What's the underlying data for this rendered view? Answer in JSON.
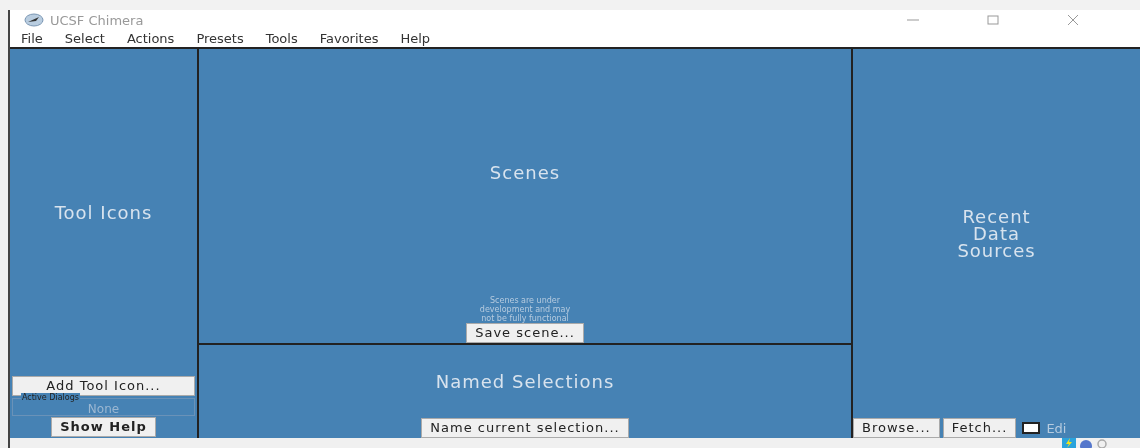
{
  "window": {
    "title": "UCSF Chimera"
  },
  "menu": [
    "File",
    "Select",
    "Actions",
    "Presets",
    "Tools",
    "Favorites",
    "Help"
  ],
  "tool_panel": {
    "title": "Tool Icons",
    "add_button": "Add Tool Icon...",
    "active_dialogs": {
      "label": "Active Dialogs",
      "value": "None"
    },
    "help_button": "Show Help"
  },
  "scenes": {
    "title": "Scenes",
    "note": "Scenes are under development and may not be fully functional",
    "save_button": "Save scene..."
  },
  "named_selections": {
    "title": "Named Selections",
    "button": "Name current selection..."
  },
  "recent": {
    "title": "Recent Data Sources",
    "buttons": [
      "Browse...",
      "Fetch..."
    ],
    "edit_checkbox": {
      "label": "Edi",
      "checked": false
    }
  }
}
